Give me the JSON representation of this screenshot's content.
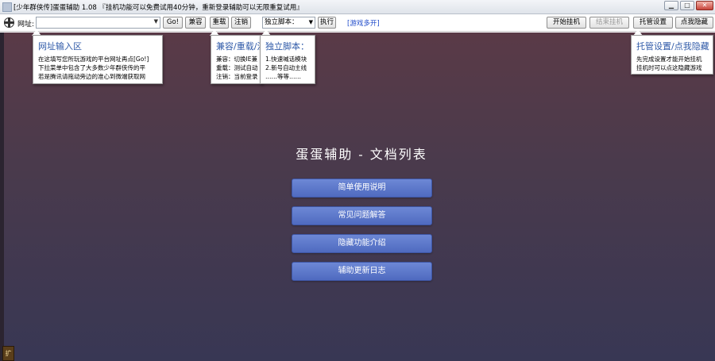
{
  "window": {
    "title": "[少年群侠传]蛋蛋辅助 1.08 『挂机功能可以免费试用40分钟，重新登录辅助可以无限重复试用』",
    "min_glyph": "▁",
    "max_glyph": "□",
    "close_glyph": "✕"
  },
  "toolbar": {
    "url_label": "网址:",
    "url_value": "",
    "go_label": "Go!",
    "compat_label": "兼容",
    "reload_label": "重载",
    "logout_label": "注销",
    "script_select_value": "独立脚本：",
    "run_label": "执行",
    "multi_link": "[游戏多开]",
    "start_label": "开始挂机",
    "stop_label": "结束挂机",
    "settings_label": "托管设置",
    "hide_label": "点我隐藏"
  },
  "tooltips": {
    "url": {
      "title": "网址输入区",
      "lines": [
        "在这填写您所玩游戏的平台网址再点[Go!]",
        "下拉菜单中包含了大多数少年群侠传的平",
        "若是腾讯请拖动旁边的准心到微端获取网"
      ]
    },
    "reload": {
      "title": "兼容/重载/注",
      "lines": [
        "兼容：切换IE兼",
        "重载：测试自动",
        "注销：当前登录"
      ]
    },
    "script": {
      "title": "独立脚本：",
      "lines": [
        "1.快速喊话模块",
        "2.新号自动主线",
        "……等等……"
      ]
    },
    "hosting": {
      "title": "托管设置/点我隐藏",
      "lines": [
        "先完成设置才能开始挂机",
        "挂机时可以点这隐藏游戏"
      ]
    }
  },
  "main": {
    "doc_title": "蛋蛋辅助 - 文档列表",
    "buttons": [
      "简单使用说明",
      "常见问题解答",
      "隐藏功能介绍",
      "辅助更新日志"
    ],
    "corner_badge": "扩"
  },
  "colors": {
    "bg_top": "#5a3a47",
    "bg_bottom": "#383754",
    "doc_button": "#5a76cc",
    "tooltip_title": "#2f5aa8",
    "link": "#1a47c9"
  }
}
